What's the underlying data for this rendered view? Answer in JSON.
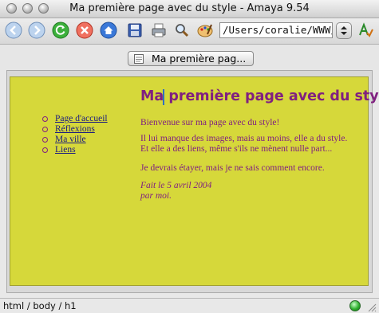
{
  "window": {
    "title": "Ma première page avec du style - Amaya 9.54"
  },
  "toolbar": {
    "address_value": "/Users/coralie/WWW/",
    "buttons": [
      "back-icon",
      "forward-icon",
      "reload-icon",
      "stop-icon",
      "home-icon",
      "save-icon",
      "print-icon",
      "find-icon",
      "style-palette-icon",
      "spellcheck-icon"
    ]
  },
  "tab": {
    "label": "Ma première pag..."
  },
  "page": {
    "heading": "Ma première page avec du style",
    "nav": [
      "Page d'accueil",
      "Réflexions",
      "Ma ville",
      "Liens"
    ],
    "welcome": "Bienvenue sur ma page avec du style!",
    "p1_line1": "Il lui manque des images, mais au moins, elle a du style.",
    "p1_line2": "Et elle a des liens, même s'ils ne mènent nulle part...",
    "p2": "Je devrais étayer, mais je ne sais comment encore.",
    "sig_line1": "Fait le 5 avril 2004",
    "sig_line2": "par moi.",
    "background_color": "#d6d83a",
    "text_color": "#802080"
  },
  "status": {
    "path": "html / body / h1",
    "indicator_color": "#30b030"
  }
}
